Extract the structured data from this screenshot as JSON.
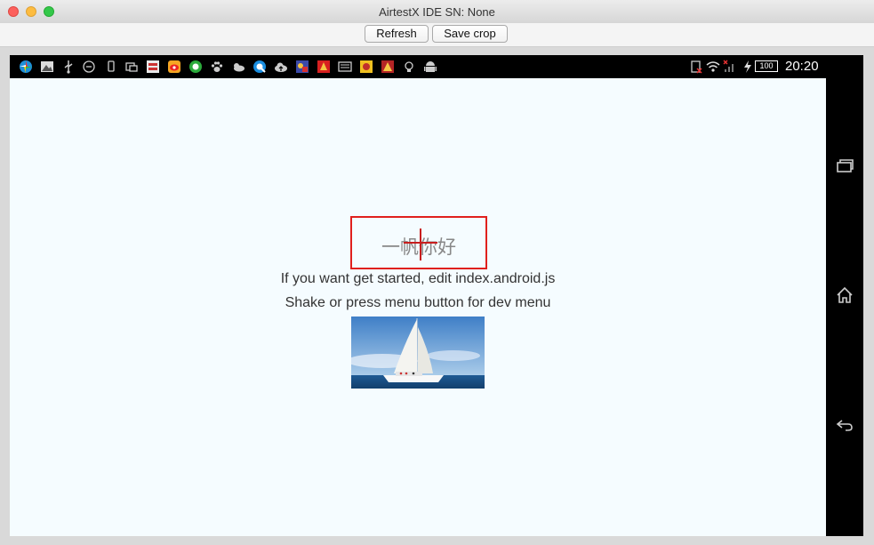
{
  "window": {
    "title": "AirtestX IDE SN: None"
  },
  "toolbar": {
    "refresh_label": "Refresh",
    "save_crop_label": "Save crop"
  },
  "status_bar": {
    "time": "20:20",
    "battery": "100",
    "left_icons": [
      "pinwheel-app-icon",
      "photo-app-icon",
      "usb-icon",
      "hotspot-icon",
      "phone-icon",
      "screen-icon",
      "news-app-icon",
      "weibo-icon",
      "wechat-icon",
      "paw-icon",
      "weather-icon",
      "qq-browser-icon",
      "cloud-upload-icon",
      "game-icon",
      "game-icon-2",
      "keyboard-icon",
      "game-icon-3",
      "lightbulb-icon",
      "android-icon"
    ],
    "right_icons": [
      "sim-icon",
      "wifi-icon",
      "signal-icon",
      "charging-icon",
      "battery-icon"
    ]
  },
  "nav_bar": {
    "buttons": [
      "recent-apps-icon",
      "home-icon",
      "back-icon"
    ]
  },
  "app": {
    "welcome": "一帆你好",
    "instructions": "If you want get started, edit index.android.js",
    "dev_menu_hint": "Shake or press menu button for dev menu",
    "image_subject": "sailboat-photo"
  },
  "colors": {
    "screen_background": "#f5fcff",
    "highlight_border": "#e0201d",
    "crosshair": "#c81e1e"
  }
}
